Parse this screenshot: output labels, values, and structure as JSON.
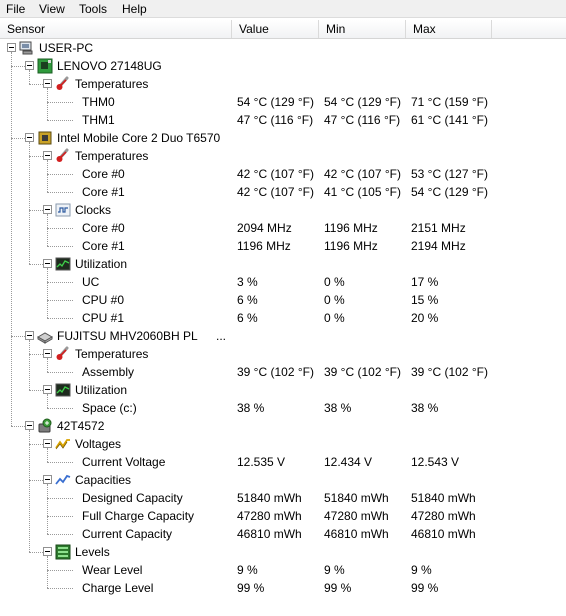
{
  "menu": [
    "File",
    "View",
    "Tools",
    "Help"
  ],
  "columns": [
    "Sensor",
    "Value",
    "Min",
    "Max"
  ],
  "rows": [
    {
      "level": 0,
      "type": "node",
      "icon": "computer-icon",
      "label": "USER-PC",
      "value": "",
      "min": "",
      "max": ""
    },
    {
      "level": 1,
      "type": "node",
      "icon": "motherboard-icon",
      "label": "LENOVO 27148UG",
      "value": "",
      "min": "",
      "max": ""
    },
    {
      "level": 2,
      "type": "node",
      "icon": "thermometer-icon",
      "label": "Temperatures",
      "value": "",
      "min": "",
      "max": ""
    },
    {
      "level": 3,
      "type": "leaf",
      "icon": "",
      "label": "THM0",
      "value": "54 °C (129 °F)",
      "min": "54 °C (129 °F)",
      "max": "71 °C (159 °F)"
    },
    {
      "level": 3,
      "type": "leaf",
      "icon": "",
      "label": "THM1",
      "value": "47 °C (116 °F)",
      "min": "47 °C (116 °F)",
      "max": "61 °C (141 °F)"
    },
    {
      "level": 1,
      "type": "node",
      "icon": "cpu-icon",
      "label": "Intel Mobile Core 2 Duo T6570",
      "value": "",
      "min": "",
      "max": ""
    },
    {
      "level": 2,
      "type": "node",
      "icon": "thermometer-icon",
      "label": "Temperatures",
      "value": "",
      "min": "",
      "max": ""
    },
    {
      "level": 3,
      "type": "leaf",
      "icon": "",
      "label": "Core #0",
      "value": "42 °C (107 °F)",
      "min": "42 °C (107 °F)",
      "max": "53 °C (127 °F)"
    },
    {
      "level": 3,
      "type": "leaf",
      "icon": "",
      "label": "Core #1",
      "value": "42 °C (107 °F)",
      "min": "41 °C (105 °F)",
      "max": "54 °C (129 °F)"
    },
    {
      "level": 2,
      "type": "node",
      "icon": "clock-icon",
      "label": "Clocks",
      "value": "",
      "min": "",
      "max": ""
    },
    {
      "level": 3,
      "type": "leaf",
      "icon": "",
      "label": "Core #0",
      "value": "2094 MHz",
      "min": "1196 MHz",
      "max": "2151 MHz"
    },
    {
      "level": 3,
      "type": "leaf",
      "icon": "",
      "label": "Core #1",
      "value": "1196 MHz",
      "min": "1196 MHz",
      "max": "2194 MHz"
    },
    {
      "level": 2,
      "type": "node",
      "icon": "utilization-icon",
      "label": "Utilization",
      "value": "",
      "min": "",
      "max": ""
    },
    {
      "level": 3,
      "type": "leaf",
      "icon": "",
      "label": "UC",
      "value": "3 %",
      "min": "0 %",
      "max": "17 %"
    },
    {
      "level": 3,
      "type": "leaf",
      "icon": "",
      "label": "CPU #0",
      "value": "6 %",
      "min": "0 %",
      "max": "15 %"
    },
    {
      "level": 3,
      "type": "leaf",
      "icon": "",
      "label": "CPU #1",
      "value": "6 %",
      "min": "0 %",
      "max": "20 %"
    },
    {
      "level": 1,
      "type": "node",
      "icon": "hdd-icon",
      "label": "FUJITSU MHV2060BH PL",
      "extra": "...",
      "value": "",
      "min": "",
      "max": ""
    },
    {
      "level": 2,
      "type": "node",
      "icon": "thermometer-icon",
      "label": "Temperatures",
      "value": "",
      "min": "",
      "max": ""
    },
    {
      "level": 3,
      "type": "leaf",
      "icon": "",
      "label": "Assembly",
      "value": "39 °C (102 °F)",
      "min": "39 °C (102 °F)",
      "max": "39 °C (102 °F)"
    },
    {
      "level": 2,
      "type": "node",
      "icon": "utilization-icon",
      "label": "Utilization",
      "value": "",
      "min": "",
      "max": ""
    },
    {
      "level": 3,
      "type": "leaf",
      "icon": "",
      "label": "Space (c:)",
      "value": "38 %",
      "min": "38 %",
      "max": "38 %"
    },
    {
      "level": 1,
      "type": "node",
      "icon": "battery-icon",
      "label": "42T4572",
      "value": "",
      "min": "",
      "max": ""
    },
    {
      "level": 2,
      "type": "node",
      "icon": "voltage-icon",
      "label": "Voltages",
      "value": "",
      "min": "",
      "max": ""
    },
    {
      "level": 3,
      "type": "leaf",
      "icon": "",
      "label": "Current Voltage",
      "value": "12.535 V",
      "min": "12.434 V",
      "max": "12.543 V"
    },
    {
      "level": 2,
      "type": "node",
      "icon": "capacity-icon",
      "label": "Capacities",
      "value": "",
      "min": "",
      "max": ""
    },
    {
      "level": 3,
      "type": "leaf",
      "icon": "",
      "label": "Designed Capacity",
      "value": "51840 mWh",
      "min": "51840 mWh",
      "max": "51840 mWh"
    },
    {
      "level": 3,
      "type": "leaf",
      "icon": "",
      "label": "Full Charge Capacity",
      "value": "47280 mWh",
      "min": "47280 mWh",
      "max": "47280 mWh"
    },
    {
      "level": 3,
      "type": "leaf",
      "icon": "",
      "label": "Current Capacity",
      "value": "46810 mWh",
      "min": "46810 mWh",
      "max": "46810 mWh"
    },
    {
      "level": 2,
      "type": "node",
      "icon": "levels-icon",
      "label": "Levels",
      "value": "",
      "min": "",
      "max": ""
    },
    {
      "level": 3,
      "type": "leaf",
      "icon": "",
      "label": "Wear Level",
      "value": "9 %",
      "min": "9 %",
      "max": "9 %"
    },
    {
      "level": 3,
      "type": "leaf",
      "icon": "",
      "label": "Charge Level",
      "value": "99 %",
      "min": "99 %",
      "max": "99 %"
    }
  ]
}
